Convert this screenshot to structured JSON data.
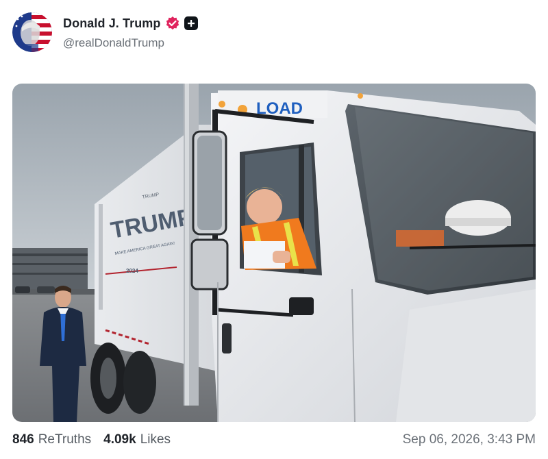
{
  "post": {
    "author": {
      "display_name": "Donald J. Trump",
      "handle": "@realDonaldTrump",
      "verified_icon": "verified-badge-icon",
      "follow_icon": "plus-icon",
      "avatar": "flag-portrait-avatar"
    },
    "image": {
      "truck_logo_text": "LOAD",
      "truck_side_small": "TRUMP",
      "truck_side_big": "TRUMP",
      "truck_side_slogan": "MAKE AMERICA GREAT AGAIN!",
      "truck_side_year": "2024"
    },
    "stats": {
      "retruths_count": "846",
      "retruths_label": "ReTruths",
      "likes_count": "4.09k",
      "likes_label": "Likes"
    },
    "timestamp": "Sep 06, 2026, 3:43 PM"
  },
  "colors": {
    "verified": "#e0245e",
    "text_primary": "#1f2329",
    "text_secondary": "#6b7178"
  }
}
